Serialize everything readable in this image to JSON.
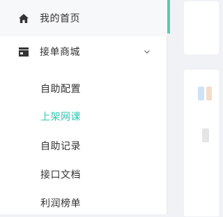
{
  "sidebar": {
    "menu": [
      {
        "label": "我的首页",
        "icon": "home-icon"
      },
      {
        "label": "接单商城",
        "icon": "shop-icon",
        "expanded": true
      }
    ],
    "submenu": [
      {
        "label": "自助配置",
        "active": false
      },
      {
        "label": "上架网课",
        "active": true
      },
      {
        "label": "自助记录",
        "active": false
      },
      {
        "label": "接口文档",
        "active": false
      },
      {
        "label": "利润榜单",
        "active": false
      }
    ]
  },
  "colors": {
    "accent": "#2ec7b0",
    "text": "#333333",
    "background": "#f0f2f5"
  }
}
